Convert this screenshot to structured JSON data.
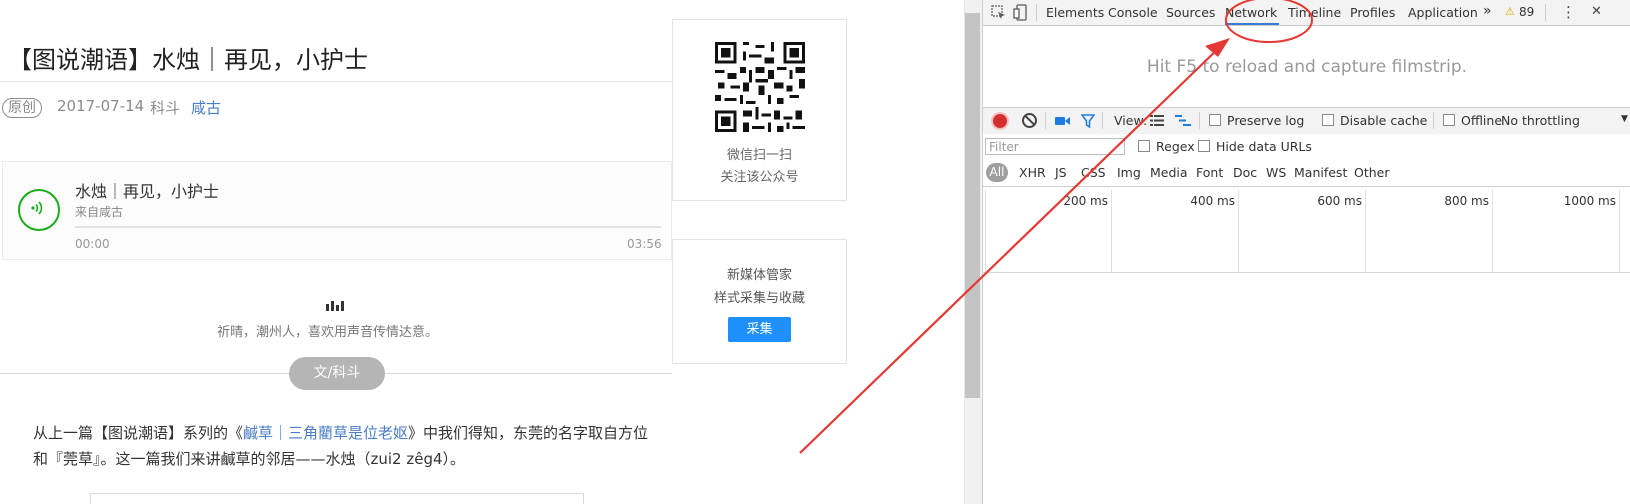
{
  "article": {
    "title": "【图说潮语】水烛｜再见，小护士",
    "original_badge": "原创",
    "date": "2017-07-14",
    "category": "科斗",
    "author": "咸古",
    "audio": {
      "title": "水烛｜再见，小护士",
      "source": "来自咸古",
      "time_start": "00:00",
      "time_end": "03:56"
    },
    "intro": "祈晴，潮州人，喜欢用声音传情达意。",
    "section_pill": "文/科斗",
    "paragraph": {
      "part1": "从上一篇【图说潮语】系列的《",
      "link": "鹹草｜三角藺草是位老妪",
      "part2": "》中我们得知，东莞的名字取自方位和『莞草』。这一篇我们来讲鹹草的邻居——水烛（zui2 zêg4）。"
    }
  },
  "sidebar": {
    "qr_line1": "微信扫一扫",
    "qr_line2": "关注该公众号",
    "collect_line1": "新媒体管家",
    "collect_line2": "样式采集与收藏",
    "collect_button": "采集"
  },
  "devtools": {
    "tabs": [
      "Elements",
      "Console",
      "Sources",
      "Network",
      "Timeline",
      "Profiles",
      "Application"
    ],
    "active_tab": "Network",
    "more": "»",
    "warning_count": "89",
    "menu": "⋮",
    "close": "✕",
    "filmstrip_hint": "Hit F5 to reload and capture filmstrip.",
    "controls": {
      "view_label": "View:",
      "preserve_log": "Preserve log",
      "disable_cache": "Disable cache",
      "offline": "Offline",
      "throttling": "No throttling"
    },
    "filter_placeholder": "Filter",
    "regex": "Regex",
    "hide_data_urls": "Hide data URLs",
    "types": [
      "All",
      "XHR",
      "JS",
      "CSS",
      "Img",
      "Media",
      "Font",
      "Doc",
      "WS",
      "Manifest",
      "Other"
    ],
    "ticks": [
      "200 ms",
      "400 ms",
      "600 ms",
      "800 ms",
      "1000 ms"
    ]
  },
  "annotation": {
    "color": "#e53935"
  }
}
